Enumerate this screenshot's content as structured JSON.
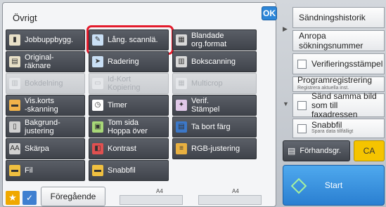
{
  "panel": {
    "title": "Övrigt",
    "ok_label": "OK"
  },
  "buttons": [
    {
      "label": "Jobbuppbygg.",
      "icon": "job-build-icon",
      "enabled": true
    },
    {
      "label": "Lång. scannlä.",
      "icon": "long-scan-icon",
      "enabled": true,
      "highlighted": true
    },
    {
      "label": "Blandade\norg.format",
      "icon": "mixed-format-icon",
      "enabled": true
    },
    {
      "label": "Original-\nräknare",
      "icon": "original-counter-icon",
      "enabled": true
    },
    {
      "label": "Radering",
      "icon": "erase-icon",
      "enabled": true
    },
    {
      "label": "Bokscanning",
      "icon": "book-scan-icon",
      "enabled": true
    },
    {
      "label": "Bokdelning",
      "icon": "book-divide-icon",
      "enabled": false
    },
    {
      "label": "Id-Kort\nKopiering",
      "icon": "id-card-icon",
      "enabled": false
    },
    {
      "label": "Multicrop",
      "icon": "multicrop-icon",
      "enabled": false
    },
    {
      "label": "Vis.korts\n-skanning",
      "icon": "card-scan-icon",
      "enabled": true
    },
    {
      "label": "Timer",
      "icon": "timer-icon",
      "enabled": true
    },
    {
      "label": "Verif.\nStämpel",
      "icon": "stamp-icon",
      "enabled": true
    },
    {
      "label": "Bakgrund-\njustering",
      "icon": "background-adjust-icon",
      "enabled": true
    },
    {
      "label": "Tom sida\nHoppa över",
      "icon": "skip-blank-icon",
      "enabled": true
    },
    {
      "label": "Ta bort färg",
      "icon": "remove-color-icon",
      "enabled": true
    },
    {
      "label": "Skärpa",
      "icon": "sharpness-icon",
      "enabled": true
    },
    {
      "label": "Kontrast",
      "icon": "contrast-icon",
      "enabled": true
    },
    {
      "label": "RGB-justering",
      "icon": "rgb-icon",
      "enabled": true
    },
    {
      "label": "Fil",
      "icon": "folder-icon",
      "enabled": true
    },
    {
      "label": "Snabbfil",
      "icon": "quick-file-icon",
      "enabled": true
    }
  ],
  "right": {
    "history_label": "Sändningshistorik",
    "recall_label": "Anropa sökningsnummer",
    "verify_stamp_label": "Verifieringsstämpel",
    "program_label": "Programregistrering",
    "program_sub": "Registrera aktuella inst.",
    "send_same_label": "Sänd samma bild som till faxadressen",
    "quick_file_label": "Snabbfil",
    "quick_file_sub": "Spara data tillfälligt",
    "preview_label": "Förhandsgr.",
    "ca_label": "CA",
    "start_label": "Start"
  },
  "bottom": {
    "previous_label": "Föregående",
    "tray_left": "A4",
    "tray_right": "A4"
  },
  "colors": {
    "accent": "#2d86d8",
    "highlight": "#e41b2c",
    "ca": "#f5c400",
    "start": "#3a94e2"
  }
}
